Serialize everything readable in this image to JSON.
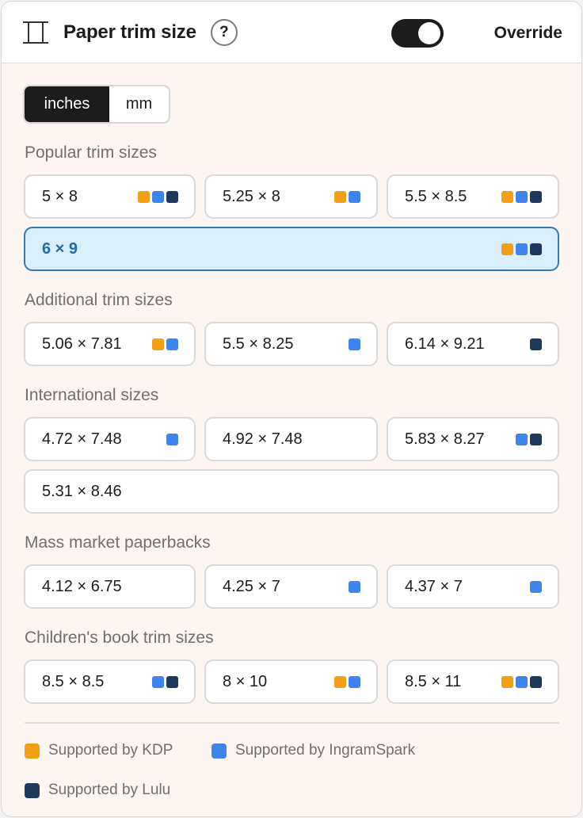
{
  "header": {
    "title": "Paper trim size",
    "help_label": "?",
    "override_label": "Override",
    "override_on": true,
    "icon": "trim-size-icon"
  },
  "units": {
    "options": [
      "inches",
      "mm"
    ],
    "selected": "inches"
  },
  "colors": {
    "kdp": "#f29f15",
    "ingramspark": "#3e84ee",
    "lulu": "#1f385e",
    "selected_bg": "#daeefb",
    "selected_border": "#2f78b4"
  },
  "sections": {
    "popular": {
      "title": "Popular trim sizes",
      "items": [
        {
          "label": "5 × 8",
          "platforms": [
            "kdp",
            "ingram",
            "lulu"
          ]
        },
        {
          "label": "5.25 × 8",
          "platforms": [
            "kdp",
            "ingram"
          ]
        },
        {
          "label": "5.5 × 8.5",
          "platforms": [
            "kdp",
            "ingram",
            "lulu"
          ]
        },
        {
          "label": "6 × 9",
          "platforms": [
            "kdp",
            "ingram",
            "lulu"
          ],
          "selected": true
        }
      ]
    },
    "additional": {
      "title": "Additional trim sizes",
      "items": [
        {
          "label": "5.06 × 7.81",
          "platforms": [
            "kdp",
            "ingram"
          ]
        },
        {
          "label": "5.5 × 8.25",
          "platforms": [
            "ingram"
          ]
        },
        {
          "label": "6.14 × 9.21",
          "platforms": [
            "lulu"
          ]
        }
      ]
    },
    "international": {
      "title": "International sizes",
      "items": [
        {
          "label": "4.72 × 7.48",
          "platforms": [
            "ingram"
          ]
        },
        {
          "label": "4.92 × 7.48",
          "platforms": []
        },
        {
          "label": "5.83 × 8.27",
          "platforms": [
            "ingram",
            "lulu"
          ]
        },
        {
          "label": "5.31 × 8.46",
          "platforms": []
        }
      ]
    },
    "mass_market": {
      "title": "Mass market paperbacks",
      "items": [
        {
          "label": "4.12 × 6.75",
          "platforms": []
        },
        {
          "label": "4.25 × 7",
          "platforms": [
            "ingram"
          ]
        },
        {
          "label": "4.37 × 7",
          "platforms": [
            "ingram"
          ]
        }
      ]
    },
    "childrens": {
      "title": "Children's book trim sizes",
      "items": [
        {
          "label": "8.5 × 8.5",
          "platforms": [
            "ingram",
            "lulu"
          ]
        },
        {
          "label": "8 × 10",
          "platforms": [
            "kdp",
            "ingram"
          ]
        },
        {
          "label": "8.5 × 11",
          "platforms": [
            "kdp",
            "ingram",
            "lulu"
          ]
        }
      ]
    }
  },
  "legend": {
    "kdp": "Supported by KDP",
    "ingram": "Supported by IngramSpark",
    "lulu": "Supported by Lulu"
  }
}
